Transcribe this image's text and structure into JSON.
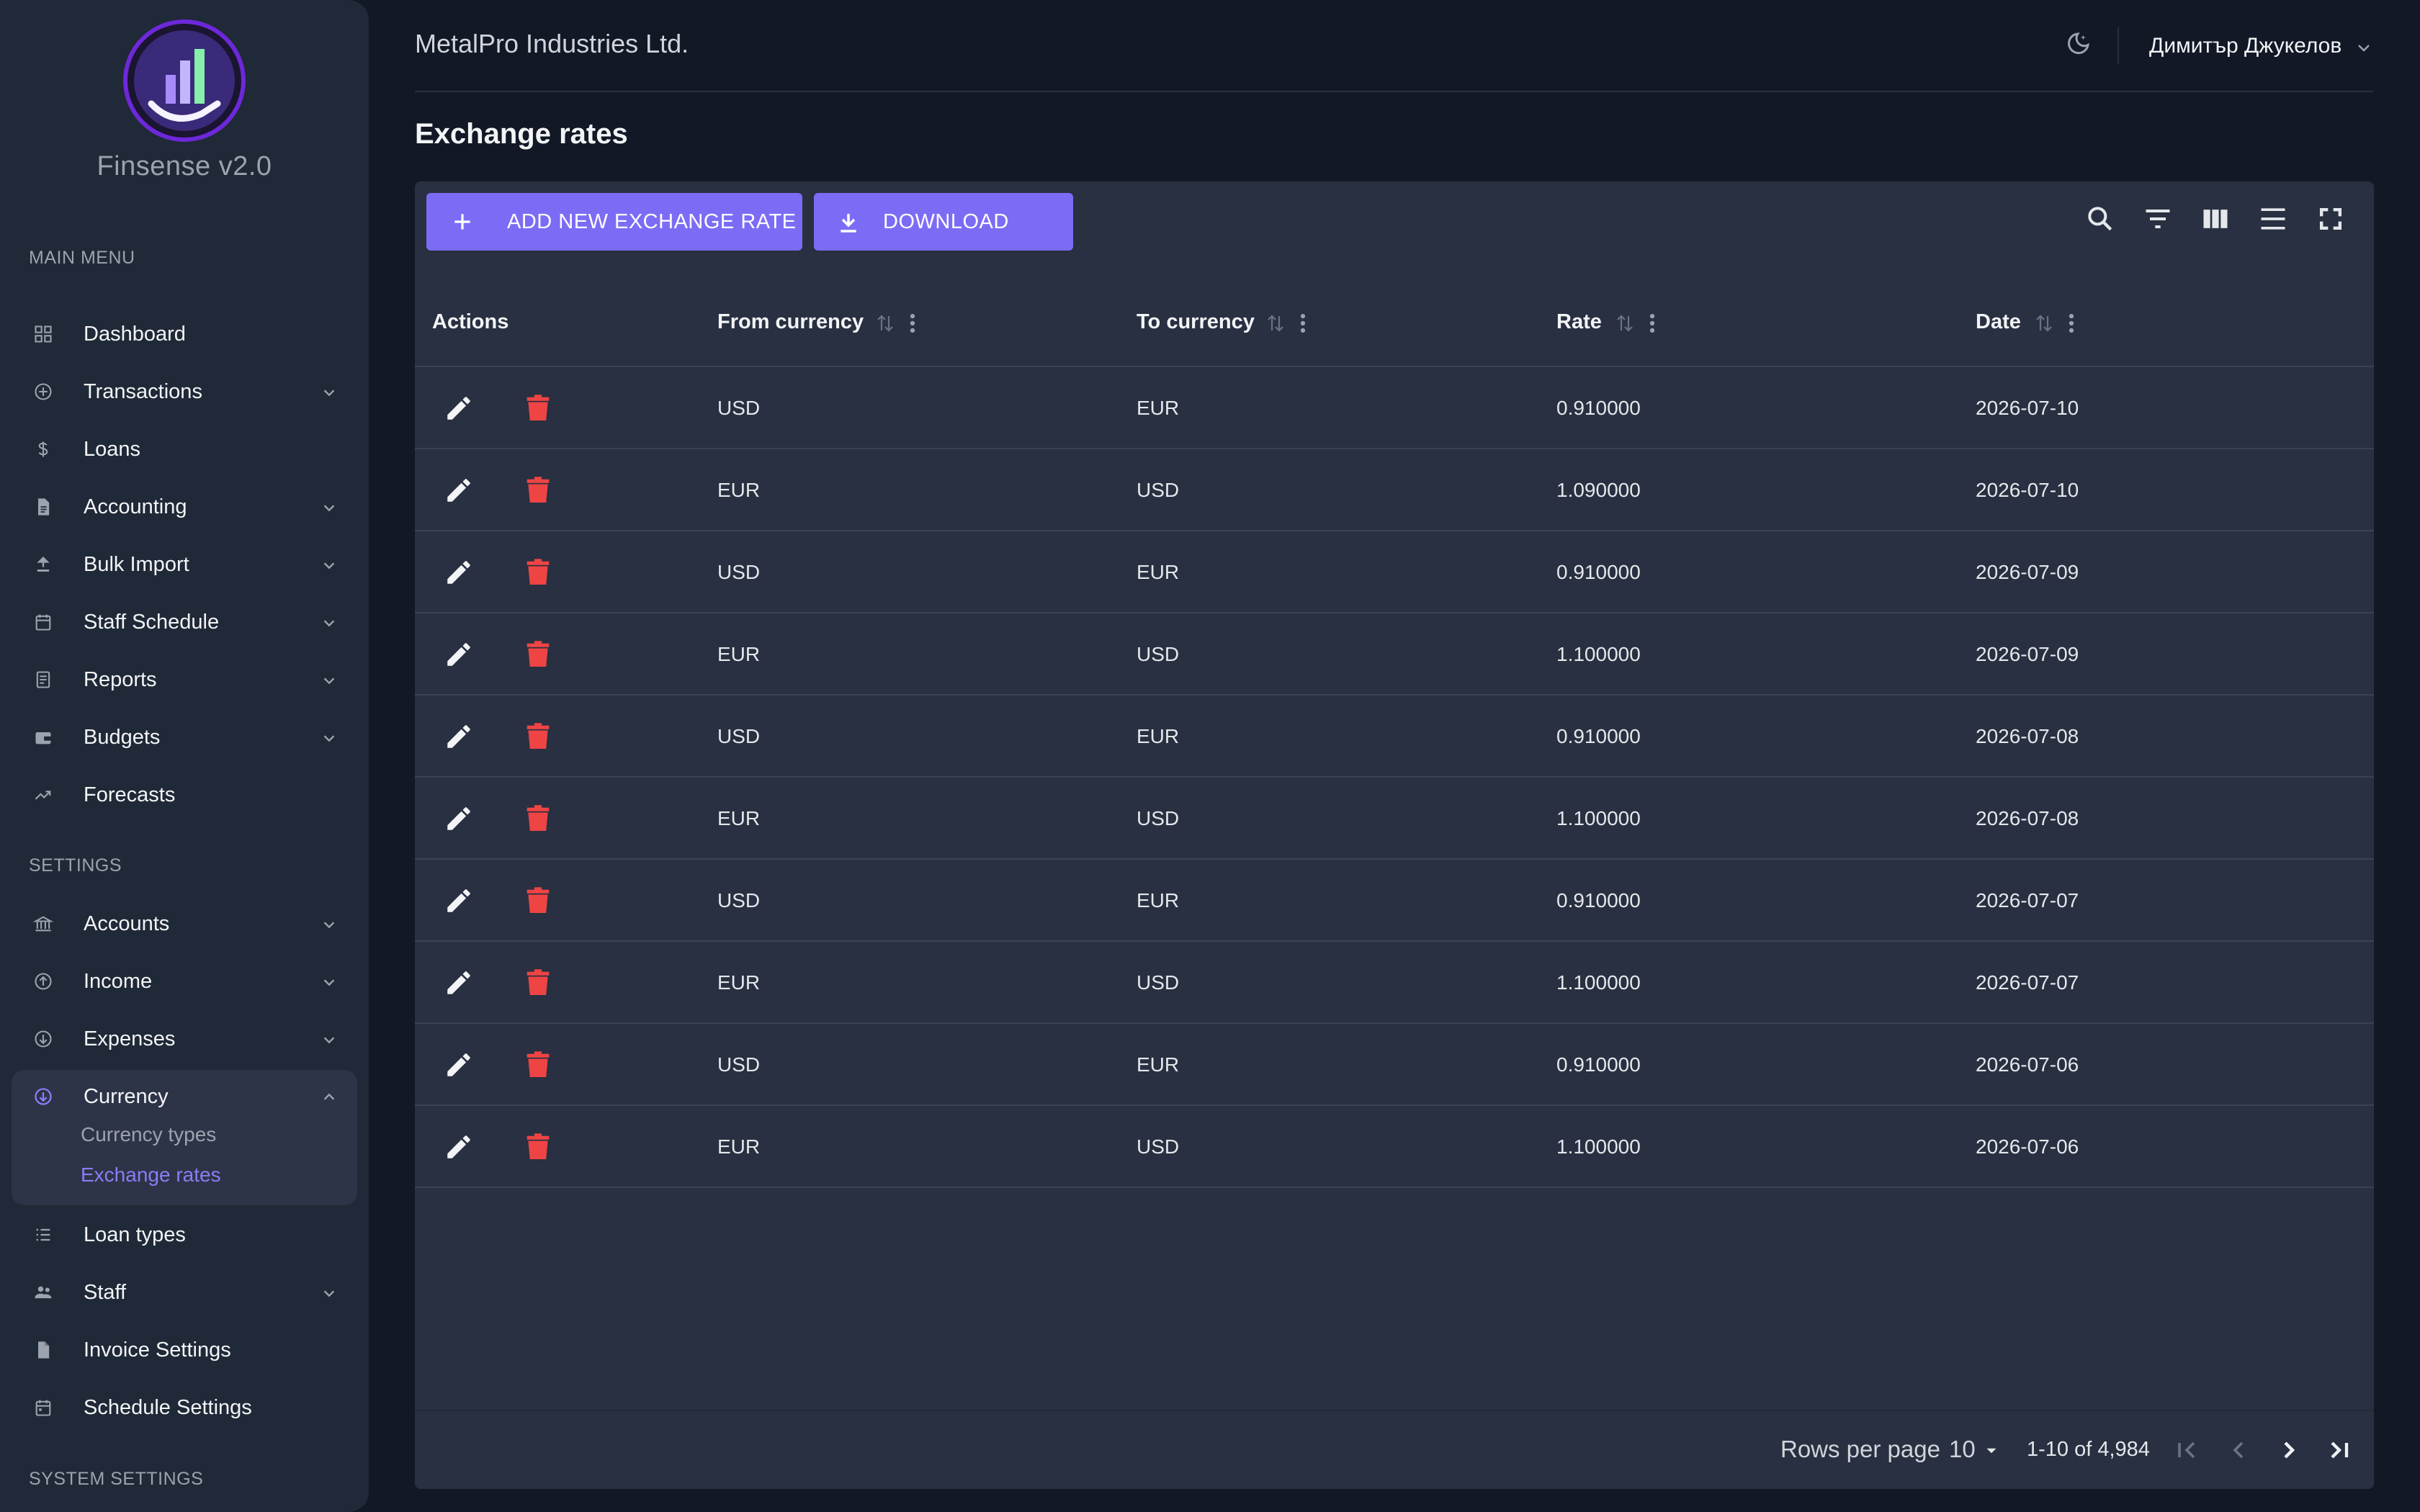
{
  "app": {
    "brand": "Finsense v2.0",
    "company": "MetalPro Industries Ltd.",
    "user": "Димитър Джукелов"
  },
  "sidebar": {
    "main_menu_title": "MAIN MENU",
    "main_items": [
      {
        "label": "Dashboard",
        "icon": "dashboard-icon",
        "expandable": false
      },
      {
        "label": "Transactions",
        "icon": "transactions-icon",
        "expandable": true
      },
      {
        "label": "Loans",
        "icon": "dollar-icon",
        "expandable": false
      },
      {
        "label": "Accounting",
        "icon": "document-icon",
        "expandable": true
      },
      {
        "label": "Bulk Import",
        "icon": "upload-icon",
        "expandable": true
      },
      {
        "label": "Staff Schedule",
        "icon": "calendar-icon",
        "expandable": true
      },
      {
        "label": "Reports",
        "icon": "report-icon",
        "expandable": true
      },
      {
        "label": "Budgets",
        "icon": "wallet-icon",
        "expandable": true
      },
      {
        "label": "Forecasts",
        "icon": "trending-icon",
        "expandable": false
      }
    ],
    "settings_title": "SETTINGS",
    "settings_items": [
      {
        "label": "Accounts",
        "icon": "bank-icon",
        "expandable": true
      },
      {
        "label": "Income",
        "icon": "income-icon",
        "expandable": true
      },
      {
        "label": "Expenses",
        "icon": "expenses-icon",
        "expandable": true
      },
      {
        "label": "Currency",
        "icon": "currency-icon",
        "expandable": true,
        "expanded": true
      },
      {
        "label": "Loan types",
        "icon": "list-icon",
        "expandable": false
      },
      {
        "label": "Staff",
        "icon": "people-icon",
        "expandable": true
      },
      {
        "label": "Invoice Settings",
        "icon": "invoice-icon",
        "expandable": false
      },
      {
        "label": "Schedule Settings",
        "icon": "schedule-icon",
        "expandable": false
      }
    ],
    "currency_sub": [
      "Currency types",
      "Exchange rates"
    ],
    "active_sub": "Exchange rates",
    "system_title": "SYSTEM SETTINGS"
  },
  "page": {
    "title": "Exchange rates",
    "add_button": "ADD NEW EXCHANGE RATE",
    "download_button": "DOWNLOAD"
  },
  "table": {
    "columns": [
      "Actions",
      "From currency",
      "To currency",
      "Rate",
      "Date"
    ],
    "rows": [
      {
        "from": "USD",
        "to": "EUR",
        "rate": "0.910000",
        "date": "2026-07-10"
      },
      {
        "from": "EUR",
        "to": "USD",
        "rate": "1.090000",
        "date": "2026-07-10"
      },
      {
        "from": "USD",
        "to": "EUR",
        "rate": "0.910000",
        "date": "2026-07-09"
      },
      {
        "from": "EUR",
        "to": "USD",
        "rate": "1.100000",
        "date": "2026-07-09"
      },
      {
        "from": "USD",
        "to": "EUR",
        "rate": "0.910000",
        "date": "2026-07-08"
      },
      {
        "from": "EUR",
        "to": "USD",
        "rate": "1.100000",
        "date": "2026-07-08"
      },
      {
        "from": "USD",
        "to": "EUR",
        "rate": "0.910000",
        "date": "2026-07-07"
      },
      {
        "from": "EUR",
        "to": "USD",
        "rate": "1.100000",
        "date": "2026-07-07"
      },
      {
        "from": "USD",
        "to": "EUR",
        "rate": "0.910000",
        "date": "2026-07-06"
      },
      {
        "from": "EUR",
        "to": "USD",
        "rate": "1.100000",
        "date": "2026-07-06"
      }
    ]
  },
  "pagination": {
    "rows_per_page_label": "Rows per page",
    "rows_per_page": "10",
    "range": "1-10 of 4,984"
  },
  "colors": {
    "accent": "#7c6cf5",
    "delete": "#ef4444",
    "background": "#121826",
    "sidebar": "#1f2937",
    "card": "#283041"
  }
}
